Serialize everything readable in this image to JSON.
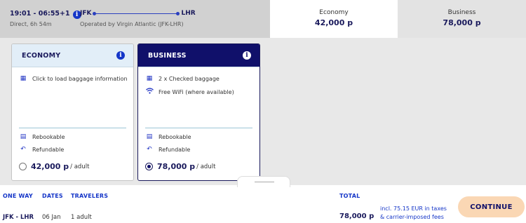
{
  "flight": {
    "times": "19:01 - 06:55+1",
    "duration": "Direct, 6h 54m",
    "from": "JFK",
    "to": "LHR",
    "operated_by": "Operated by Virgin Atlantic (JFK-LHR)"
  },
  "fare_columns": [
    {
      "name": "Economy",
      "price": "42,000 p",
      "selected": true
    },
    {
      "name": "Business",
      "price": "78,000 p",
      "selected": false
    }
  ],
  "cards": {
    "economy": {
      "title": "ECONOMY",
      "baggage": "Click to load baggage information",
      "rebookable": "Rebookable",
      "refundable": "Refundable",
      "price": "42,000 p",
      "per": "/ adult",
      "selected": false
    },
    "business": {
      "title": "BUSINESS",
      "baggage": "2 x Checked baggage",
      "wifi": "Free WiFi (where available)",
      "rebookable": "Rebookable",
      "refundable": "Refundable",
      "price": "78,000 p",
      "per": "/ adult",
      "selected": true
    }
  },
  "summary": {
    "one_way_label": "ONE WAY",
    "route": "JFK - LHR",
    "dates_label": "DATES",
    "date": "06 Jan",
    "travelers_label": "TRAVELERS",
    "travelers": "1 adult",
    "total_label": "TOTAL",
    "total": "78,000 p",
    "tax_line1": "incl. 75.15 EUR in taxes",
    "tax_line2": "& carrier-imposed fees",
    "continue_label": "CONTINUE"
  },
  "colors": {
    "navy": "#10106a",
    "accent_blue": "#1536c8",
    "continue_bg": "#fad7b4"
  }
}
